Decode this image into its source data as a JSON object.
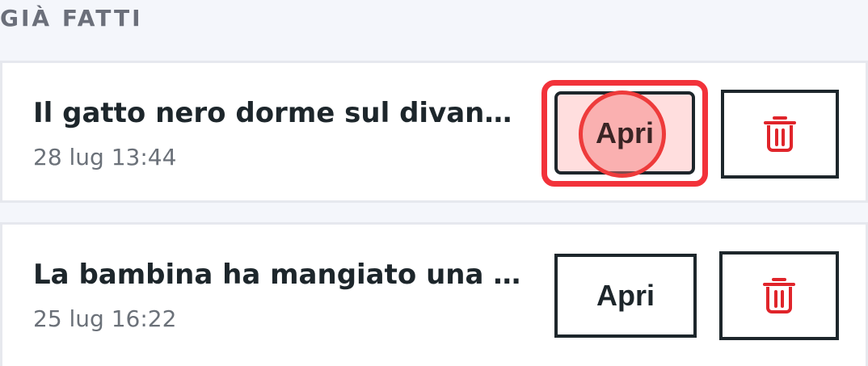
{
  "section": {
    "title": "GIÀ FATTI"
  },
  "items": [
    {
      "title": "Il gatto nero dorme sul divano…",
      "date": "28 lug 13:44",
      "open_label": "Apri",
      "delete_icon": "trash-icon"
    },
    {
      "title": "La bambina ha mangiato una mela…",
      "date": "25 lug 16:22",
      "open_label": "Apri",
      "delete_icon": "trash-icon"
    }
  ],
  "colors": {
    "text": "#1d262b",
    "muted": "#6b7179",
    "delete": "#e0242a",
    "highlight": "#f2323a",
    "background": "#f4f6fb"
  }
}
